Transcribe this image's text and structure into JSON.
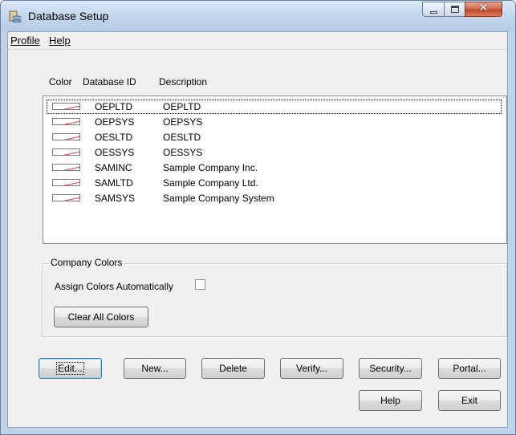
{
  "window": {
    "title": "Database Setup",
    "accent": "#bcd3ea"
  },
  "menu": {
    "profile": "Profile",
    "help": "Help"
  },
  "columns": {
    "color": "Color",
    "database_id": "Database ID",
    "description": "Description"
  },
  "databases": [
    {
      "id": "OEPLTD",
      "description": "OEPLTD"
    },
    {
      "id": "OEPSYS",
      "description": "OEPSYS"
    },
    {
      "id": "OESLTD",
      "description": "OESLTD"
    },
    {
      "id": "OESSYS",
      "description": "OESSYS"
    },
    {
      "id": "SAMINC",
      "description": "Sample Company Inc."
    },
    {
      "id": "SAMLTD",
      "description": "Sample Company Ltd."
    },
    {
      "id": "SAMSYS",
      "description": "Sample Company System"
    }
  ],
  "swatch_color": "#e03c3c",
  "company_colors": {
    "group_label": "Company Colors",
    "assign_label": "Assign Colors Automatically",
    "assign_checked": false,
    "clear_button": "Clear All Colors"
  },
  "buttons": {
    "edit": "Edit...",
    "new": "New...",
    "delete": "Delete",
    "verify": "Verify...",
    "security": "Security...",
    "portal": "Portal...",
    "help": "Help",
    "exit": "Exit"
  }
}
